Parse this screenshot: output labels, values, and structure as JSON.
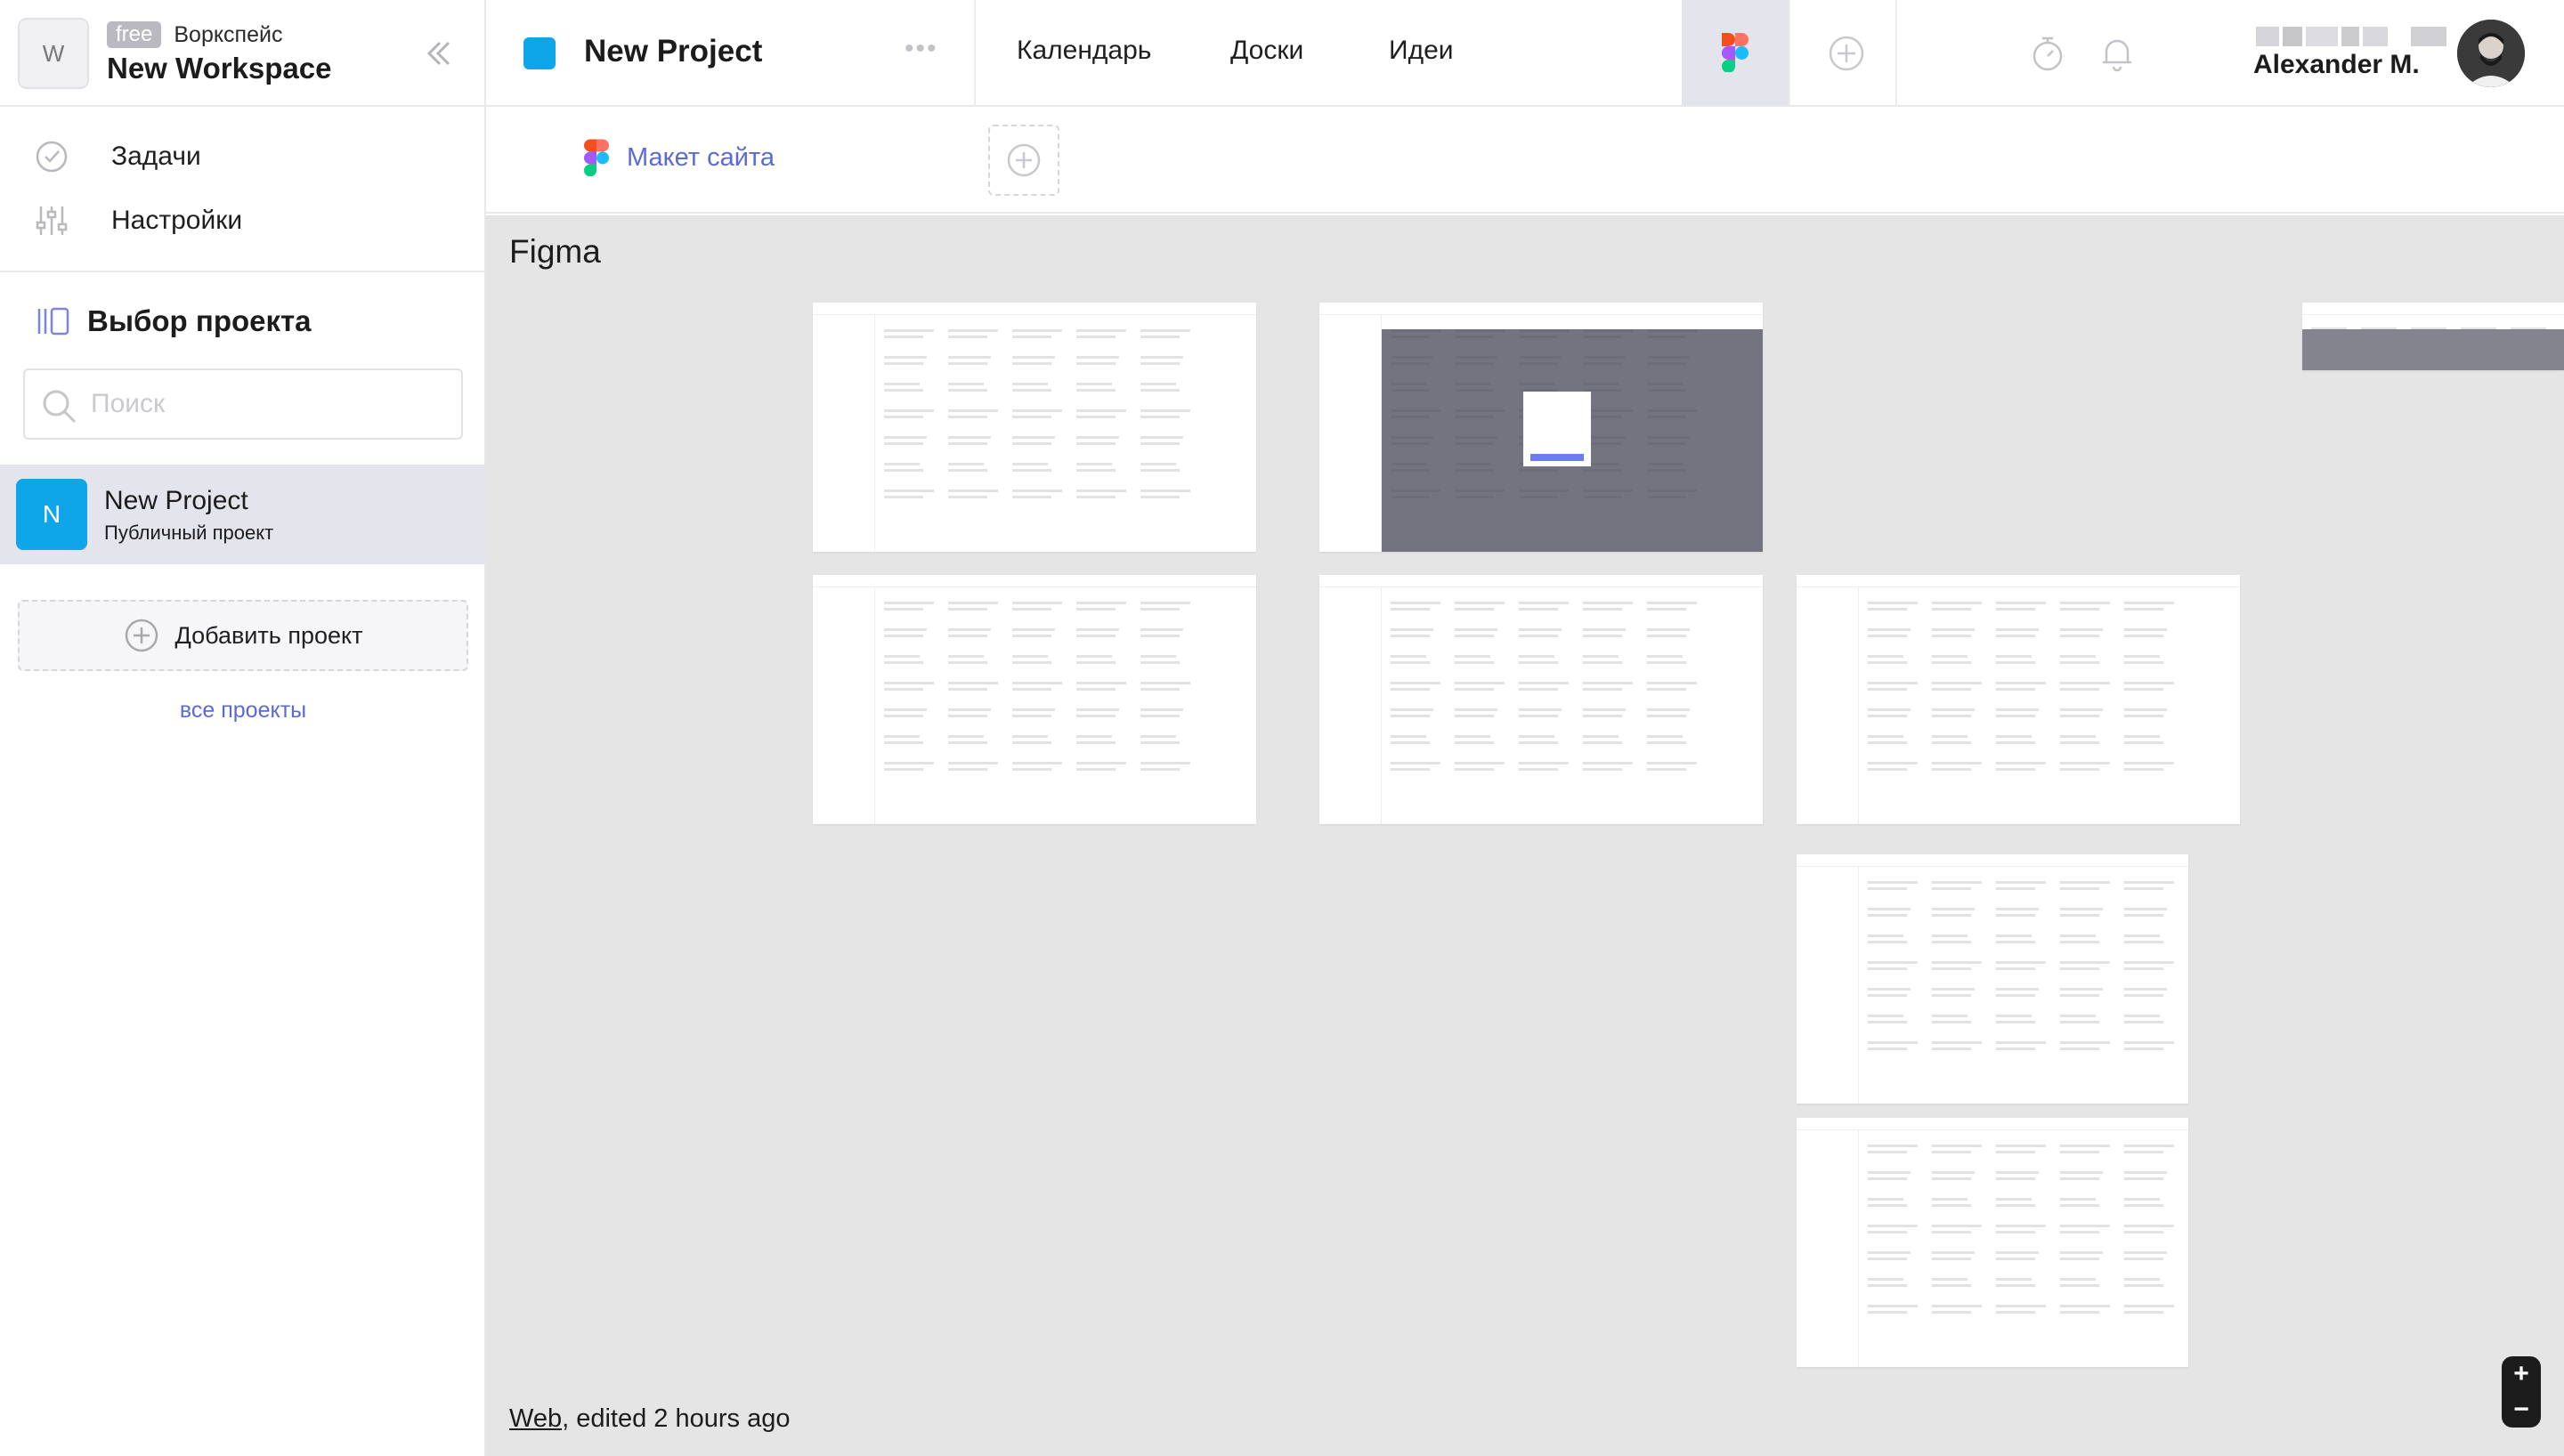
{
  "workspace": {
    "avatar_letter": "W",
    "plan_badge": "free",
    "type_label": "Воркспейс",
    "name": "New Workspace"
  },
  "nav": {
    "tasks": "Задачи",
    "settings": "Настройки"
  },
  "project_picker": {
    "title": "Выбор проекта",
    "search_placeholder": "Поиск",
    "projects": [
      {
        "letter": "N",
        "name": "New Project",
        "subtitle": "Публичный проект",
        "color": "#0ea5e9"
      }
    ],
    "add_project_label": "Добавить проект",
    "all_projects_link": "все проекты"
  },
  "header": {
    "project_name": "New Project",
    "project_color": "#0ea5e9",
    "tabs": [
      "Календарь",
      "Доски",
      "Идеи"
    ],
    "user_name": "Alexander M."
  },
  "subbar": {
    "tab_label": "Макет сайта"
  },
  "canvas": {
    "title": "Figma",
    "footer_link": "Web",
    "footer_text": ", edited 2 hours ago",
    "frame_count": 8
  },
  "zoom": {
    "in": "+",
    "out": "−"
  },
  "colors": {
    "accent": "#5b6bd6",
    "project": "#0ea5e9",
    "canvas_bg": "#e5e5e5",
    "selected_row": "#e4e4ec"
  }
}
